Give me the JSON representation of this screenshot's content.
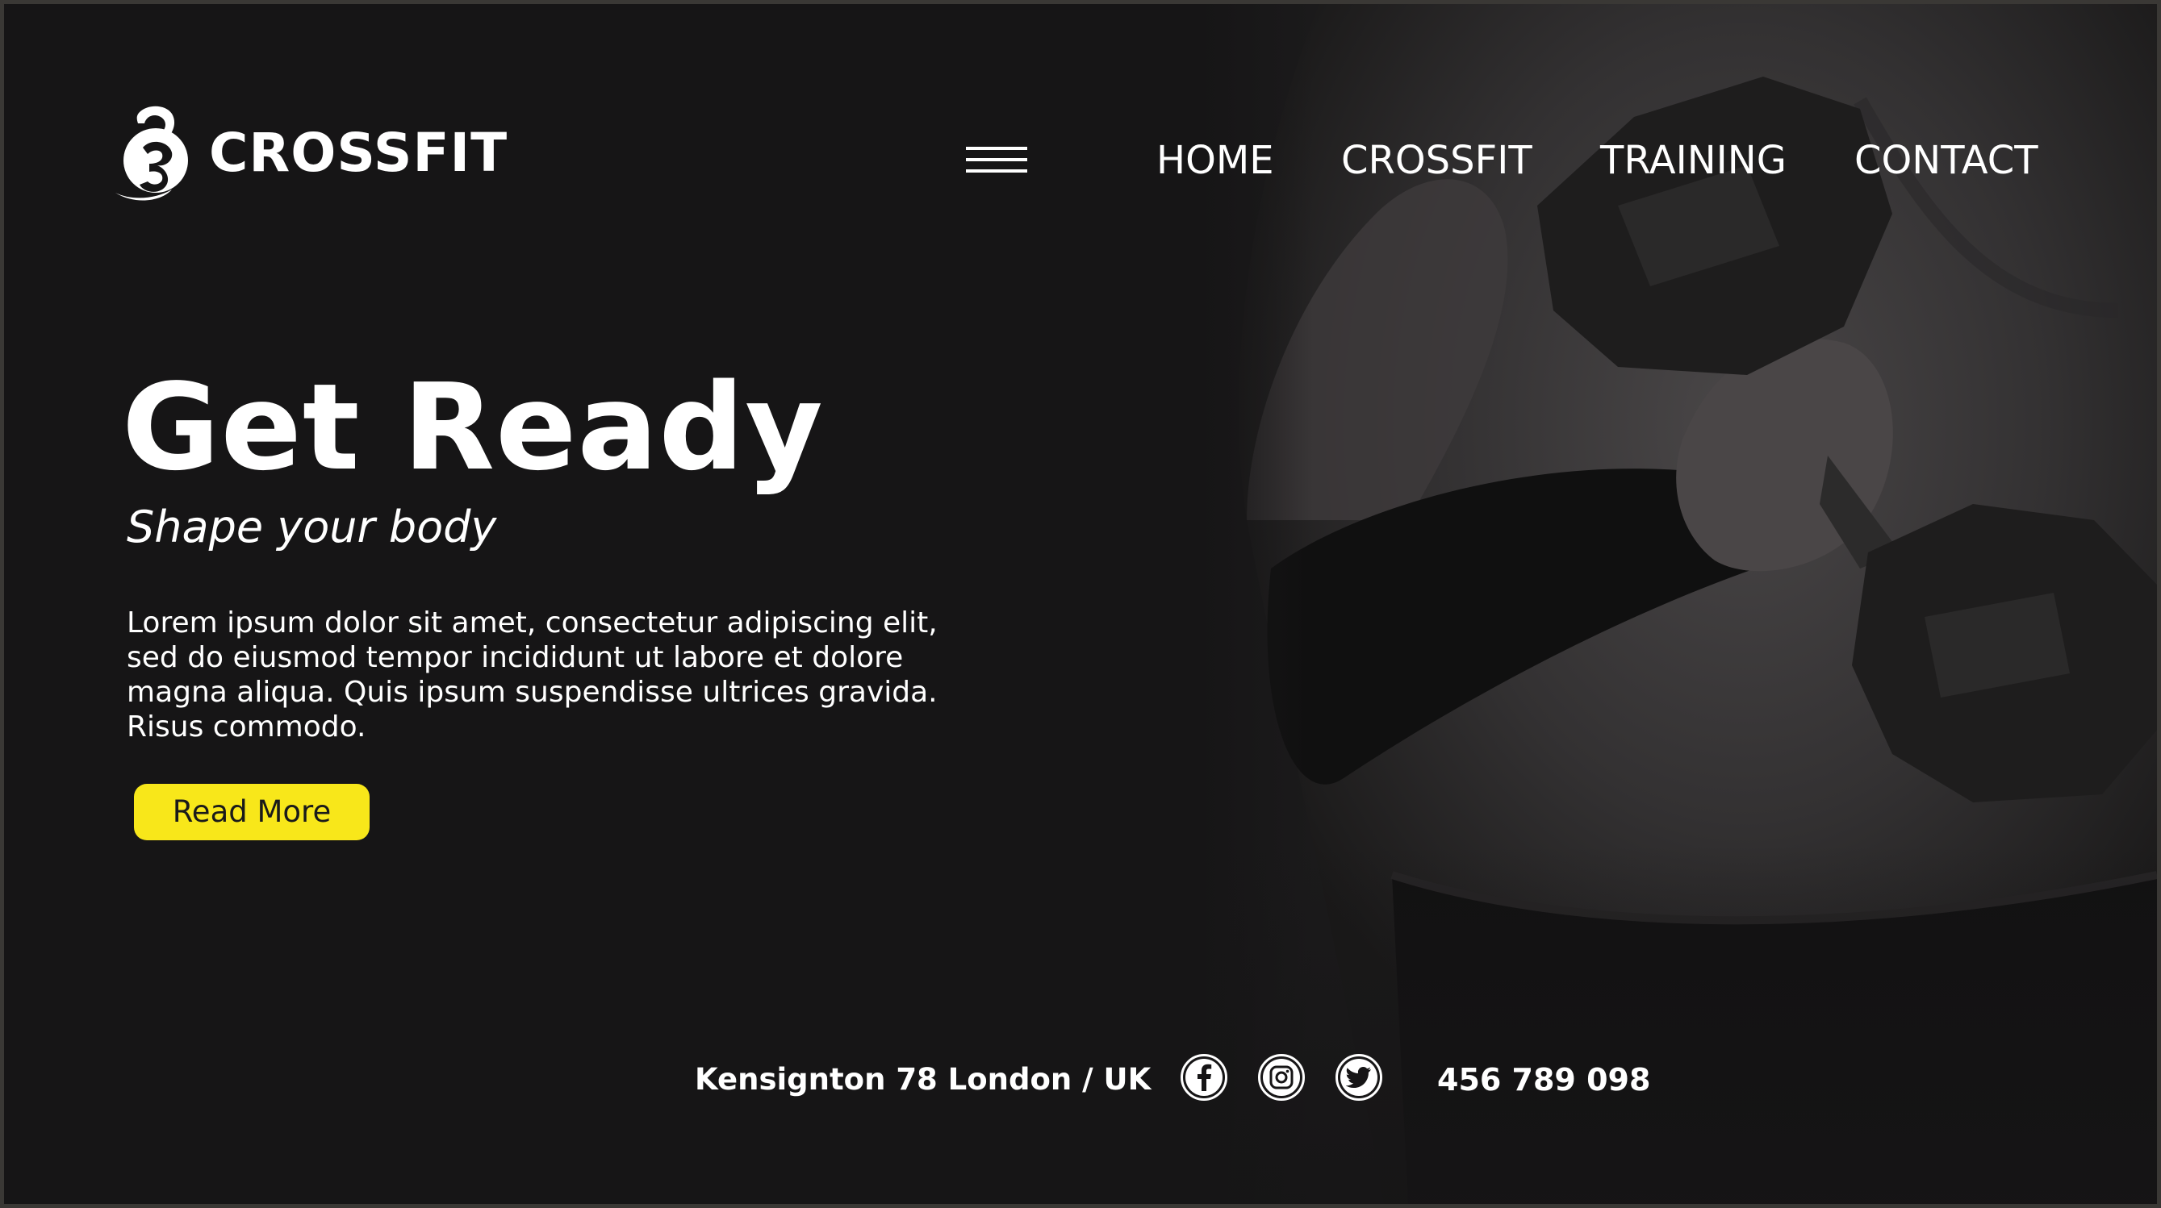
{
  "brand": {
    "name": "CROSSFIT",
    "logo_icon": "kettlebell-icon"
  },
  "nav": {
    "menu_icon": "hamburger-menu-icon",
    "items": [
      {
        "label": "HOME"
      },
      {
        "label": "CROSSFIT"
      },
      {
        "label": "TRAINING"
      },
      {
        "label": "CONTACT"
      }
    ]
  },
  "hero": {
    "title": "Get Ready",
    "subtitle": "Shape your body",
    "body": "Lorem ipsum dolor sit amet, consectetur adipiscing elit, sed do eiusmod tempor incididunt ut labore et dolore magna aliqua. Quis ipsum suspendisse ultrices gravida. Risus commodo.",
    "cta_label": "Read More",
    "image": "athlete-lifting-dumbbell-photo"
  },
  "footer": {
    "address": "Kensignton 78 London / UK",
    "phone": "456 789 098",
    "social": [
      {
        "icon": "facebook-icon"
      },
      {
        "icon": "instagram-icon"
      },
      {
        "icon": "twitter-icon"
      }
    ]
  },
  "colors": {
    "background": "#161516",
    "accent": "#f8e71a",
    "text": "#ffffff"
  }
}
